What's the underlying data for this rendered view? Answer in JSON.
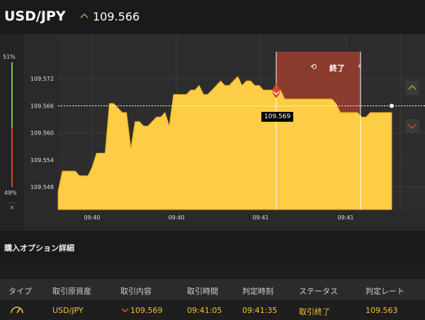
{
  "header": {
    "pair": "USD/JPY",
    "rate": "109.566"
  },
  "gauge": {
    "top_pct": "51%",
    "bottom_pct": "49%",
    "close": "×"
  },
  "chart": {
    "y_ticks": [
      "109.572",
      "109.566",
      "109.560",
      "109.554",
      "109.548"
    ],
    "x_ticks": [
      "09:40",
      "09:40",
      "09:41",
      "09:41"
    ],
    "end_label": "終了",
    "tooltip": "109.569"
  },
  "chart_data": {
    "type": "area",
    "ylim": [
      109.543,
      109.578
    ],
    "y_ticks": [
      109.572,
      109.566,
      109.56,
      109.554,
      109.548
    ],
    "x_ticks": [
      "09:40",
      "09:40",
      "09:41",
      "09:41"
    ],
    "series": [
      {
        "values": [
          109.547,
          109.5515,
          109.5515,
          109.5515,
          109.5515,
          109.5505,
          109.5505,
          109.5505,
          109.5525,
          109.5555,
          109.5555,
          109.5555,
          109.5665,
          109.5665,
          109.5655,
          109.5645,
          109.5645,
          109.5565,
          109.5625,
          109.5625,
          109.5615,
          109.5615,
          109.5625,
          109.5635,
          109.5635,
          109.5645,
          109.5615,
          109.5685,
          109.5685,
          109.5685,
          109.5685,
          109.5695,
          109.5695,
          109.5705,
          109.5685,
          109.5685,
          109.5695,
          109.5705,
          109.5715,
          109.5705,
          109.5705,
          109.5715,
          109.5725,
          109.5705,
          109.5715,
          109.5715,
          109.5705,
          109.5705,
          109.5695,
          109.5695,
          109.5695,
          109.5695,
          109.5695,
          109.5675,
          109.5675,
          109.5675,
          109.5675,
          109.5675,
          109.5675,
          109.5675,
          109.5675,
          109.5675,
          109.5675,
          109.5675,
          109.5675,
          109.5665,
          109.5645,
          109.5645,
          109.5645,
          109.5645,
          109.5645,
          109.5635,
          109.5635,
          109.5645,
          109.5645,
          109.5645,
          109.5645,
          109.5645,
          109.5645
        ]
      }
    ],
    "entry_rate": 109.566,
    "bet_rate": 109.569,
    "legend": "none",
    "grid": true
  },
  "section": {
    "title": "購入オプション詳細"
  },
  "table": {
    "headers": [
      "タイプ",
      "取引原資産",
      "取引内容",
      "取引時間",
      "判定時刻",
      "ステータス",
      "判定レート"
    ],
    "row": {
      "asset": "USD/JPY",
      "content": "109.569",
      "trade_time": "09:41:05",
      "judge_time": "09:41:35",
      "status": "取引終了",
      "rate": "109.563"
    }
  },
  "colors": {
    "area": "#fccd45",
    "up": "#7fc34a",
    "down": "#d9472b",
    "bg": "#2a2a2a",
    "shade": "#8b3a2e"
  }
}
